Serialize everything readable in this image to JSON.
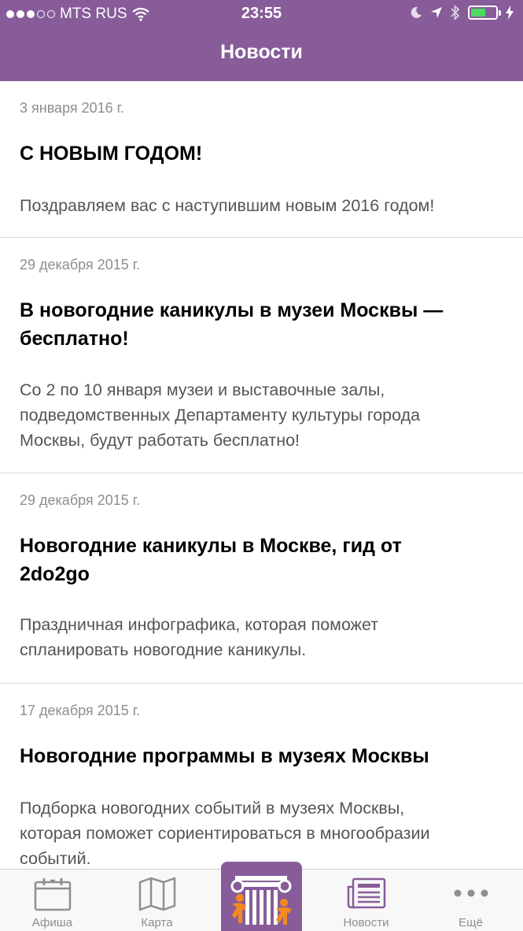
{
  "status": {
    "carrier": "MTS RUS",
    "time": "23:55"
  },
  "nav": {
    "title": "Новости"
  },
  "news": [
    {
      "date": "3 января 2016 г.",
      "title": "С НОВЫМ ГОДОМ!",
      "body": "Поздравляем вас с наступившим новым 2016 годом!"
    },
    {
      "date": "29 декабря 2015 г.",
      "title_line1": "В новогодние каникулы в музеи Москвы —",
      "title_line2": "бесплатно!",
      "body_line1": "Со 2 по 10 января музеи и выставочные залы,",
      "body_line2": "подведомственных Департаменту культуры города",
      "body_line3": "Москвы, будут работать бесплатно!"
    },
    {
      "date": "29 декабря 2015 г.",
      "title_line1": "Новогодние каникулы в Москве, гид от",
      "title_line2": "2do2go",
      "body_line1": "Праздничная инфографика, которая поможет",
      "body_line2": "спланировать новогодние каникулы."
    },
    {
      "date": "17 декабря 2015 г.",
      "title": "Новогодние программы в музеях Москвы",
      "body_line1": "Подборка новогодних событий в музеях Москвы,",
      "body_line2": "которая поможет сориентироваться в многообразии",
      "body_line3": "событий."
    }
  ],
  "tabs": [
    {
      "label": "Афиша",
      "icon": "calendar-icon"
    },
    {
      "label": "Карта",
      "icon": "map-icon"
    },
    {
      "label": "",
      "icon": "museum-column-icon"
    },
    {
      "label": "Новости",
      "icon": "newspaper-icon"
    },
    {
      "label": "Ещё",
      "icon": "more-dots-icon"
    }
  ],
  "colors": {
    "accent": "#875c99",
    "battery": "#4cd964",
    "date_text": "#8e8e93",
    "tab_inactive": "#8e8e93"
  }
}
